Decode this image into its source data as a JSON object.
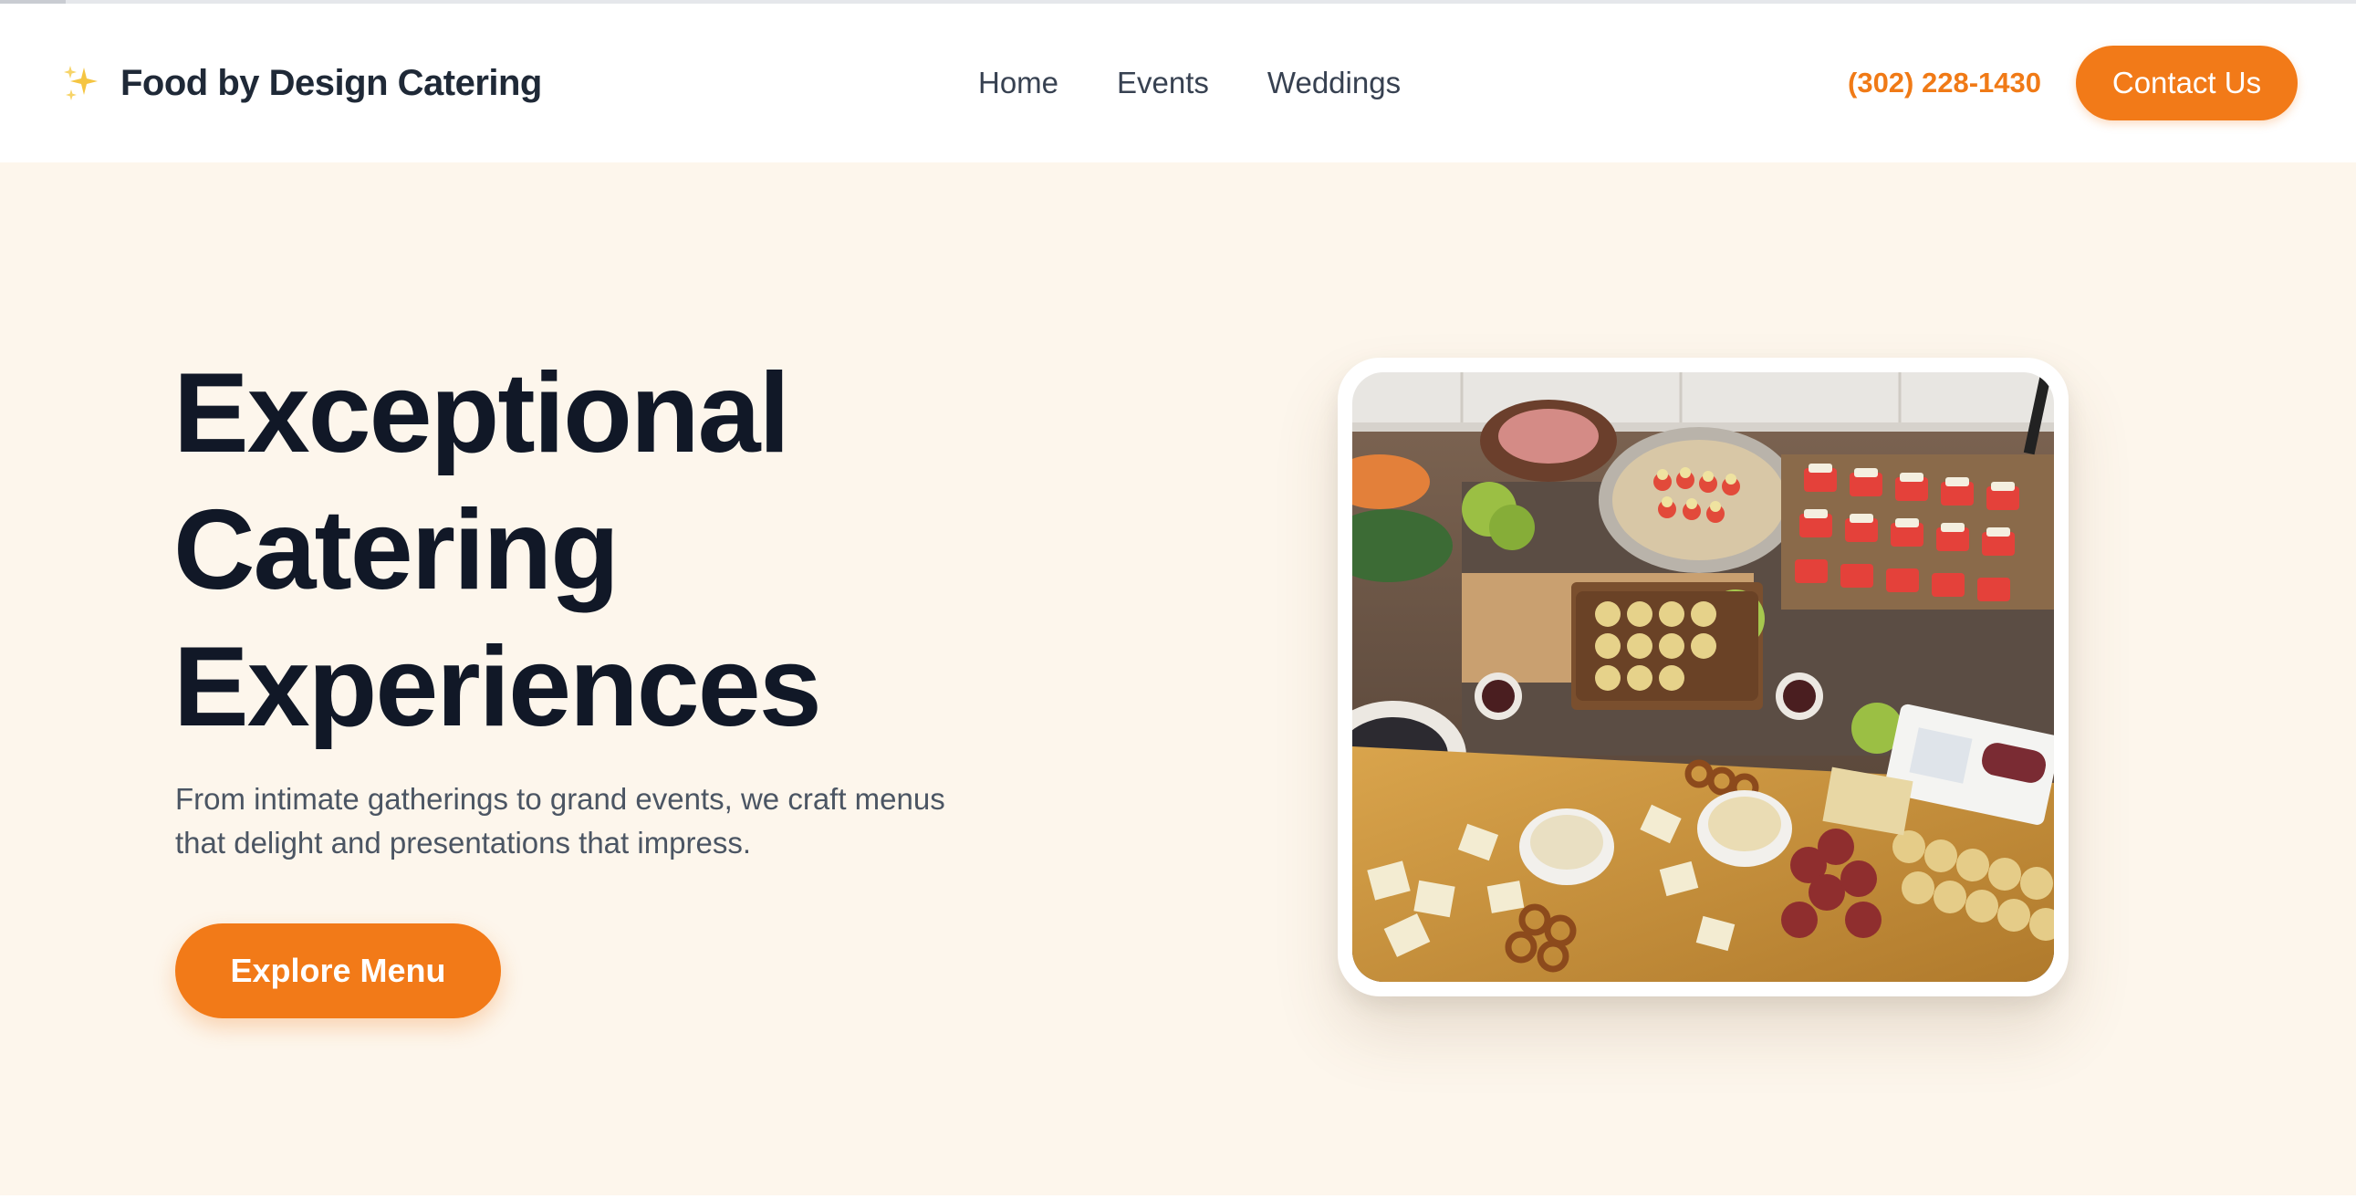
{
  "brand": {
    "icon": "sparkles-icon",
    "name": "Food by Design Catering"
  },
  "nav": {
    "items": [
      {
        "label": "Home"
      },
      {
        "label": "Events"
      },
      {
        "label": "Weddings"
      }
    ]
  },
  "header": {
    "phone": "(302) 228-1430",
    "contact_label": "Contact Us"
  },
  "hero": {
    "title_lines": [
      "Exceptional",
      "Catering",
      "Experiences"
    ],
    "subtitle_line1": "From intimate gatherings to grand events, we craft menus",
    "subtitle_line2": "that delight and presentations that impress.",
    "cta_label": "Explore Menu",
    "image_subject": "Grazing table with charcuterie, cheeses, crackers, fruit and dips"
  },
  "colors": {
    "accent": "#f27a18",
    "heading": "#111827",
    "body_text": "#4b5563",
    "hero_background": "#fdf6ec",
    "header_background": "#ffffff"
  }
}
